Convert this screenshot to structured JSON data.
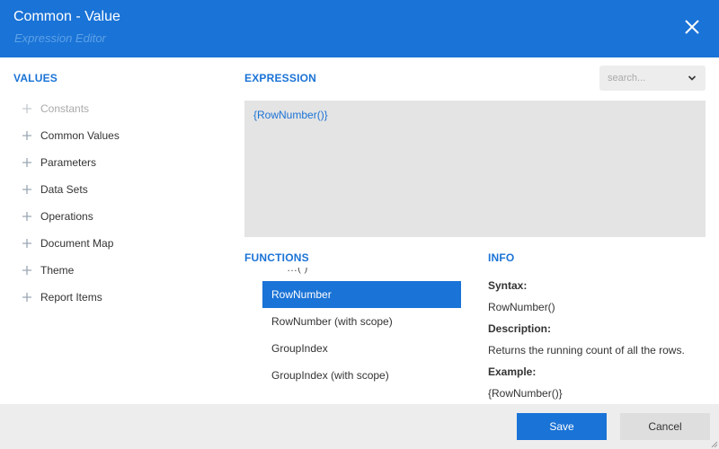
{
  "dialog": {
    "title": "Common - Value",
    "subtitle": "Expression Editor",
    "close_icon": "close-icon",
    "accent_color": "#1a73d6"
  },
  "values": {
    "heading": "VALUES",
    "items": [
      {
        "label": "Constants",
        "icon": "plus-icon",
        "disabled": true
      },
      {
        "label": "Common Values",
        "icon": "plus-icon"
      },
      {
        "label": "Parameters",
        "icon": "plus-icon"
      },
      {
        "label": "Data Sets",
        "icon": "plus-icon"
      },
      {
        "label": "Operations",
        "icon": "plus-icon"
      },
      {
        "label": "Document Map",
        "icon": "plus-icon"
      },
      {
        "label": "Theme",
        "icon": "plus-icon"
      },
      {
        "label": "Report Items",
        "icon": "plus-icon"
      }
    ]
  },
  "expression": {
    "heading": "EXPRESSION",
    "value": "{RowNumber()}"
  },
  "search": {
    "placeholder": "search...",
    "icon": "chevron-down-icon"
  },
  "functions": {
    "heading": "FUNCTIONS",
    "peek_label": "…(                     )",
    "items": [
      {
        "label": "RowNumber",
        "selected": true
      },
      {
        "label": "RowNumber (with scope)"
      },
      {
        "label": "GroupIndex"
      },
      {
        "label": "GroupIndex (with scope)"
      }
    ]
  },
  "info": {
    "heading": "INFO",
    "syntax_label": "Syntax:",
    "syntax": "RowNumber()",
    "description_label": "Description:",
    "description": "Returns the running count of all the rows.",
    "example_label": "Example:",
    "example": "{RowNumber()}"
  },
  "footer": {
    "save_label": "Save",
    "cancel_label": "Cancel"
  }
}
